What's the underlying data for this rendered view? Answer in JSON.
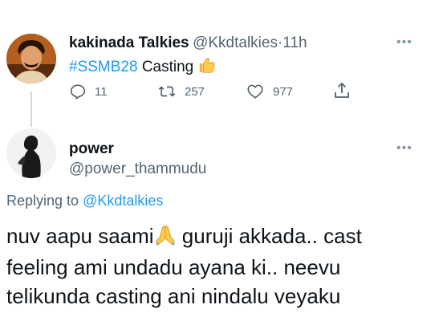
{
  "parent_tweet": {
    "author_name": "kakinada Talkies",
    "author_handle": "@Kkdtalkies",
    "separator": "·",
    "time_ago": "11h",
    "hashtag": "#SSMB28",
    "text_after_hashtag": "Casting",
    "emoji": "thumbs-up",
    "reply_count": "11",
    "retweet_count": "257",
    "like_count": "977",
    "more_label": "•••"
  },
  "reply_tweet": {
    "author_name": "power",
    "author_handle": "@power_thammudu",
    "more_label": "•••",
    "replying_to_prefix": "Replying to",
    "replying_to_handle": "@Kkdtalkies",
    "line1_before_emoji": "nuv aapu saami",
    "emoji": "folded-hands",
    "line1_after_emoji": " guruji akkada.. cast",
    "line2": "feeling ami undadu ayana ki.. neevu",
    "line3": "telikunda casting ani nindalu veyaku"
  },
  "colors": {
    "link": "#1d9bf0",
    "secondary_text": "#536471",
    "primary_text": "#0f1419",
    "thread_line": "#cfd9de"
  }
}
